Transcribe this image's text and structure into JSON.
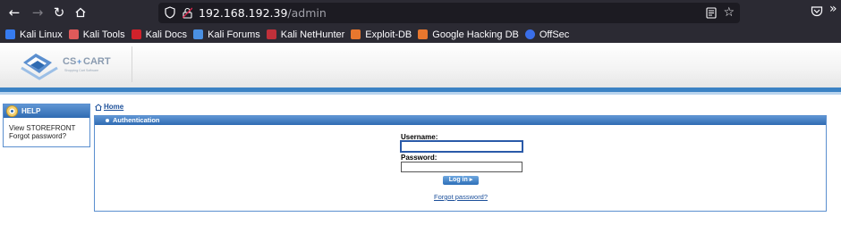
{
  "browser": {
    "url_host": "192.168.192.39",
    "url_path": "/admin",
    "bookmarks": [
      {
        "label": "Kali Linux",
        "icon": "kali-dragon-icon"
      },
      {
        "label": "Kali Tools",
        "icon": "kali-tools-icon"
      },
      {
        "label": "Kali Docs",
        "icon": "kali-docs-icon"
      },
      {
        "label": "Kali Forums",
        "icon": "kali-forums-icon"
      },
      {
        "label": "Kali NetHunter",
        "icon": "kali-nethunter-icon"
      },
      {
        "label": "Exploit-DB",
        "icon": "exploit-db-icon"
      },
      {
        "label": "Google Hacking DB",
        "icon": "ghdb-icon"
      },
      {
        "label": "OffSec",
        "icon": "offsec-icon"
      }
    ]
  },
  "sidebar": {
    "help_title": "HELP",
    "links": [
      "View STOREFRONT",
      "Forgot password?"
    ]
  },
  "breadcrumb": {
    "home_label": "Home"
  },
  "auth": {
    "title": "Authentication",
    "username_label": "Username:",
    "password_label": "Password:",
    "login_button": "Log in",
    "forgot_link": "Forgot password?"
  },
  "colors": {
    "accent": "#3b82c4",
    "link": "#1b4f9a",
    "browser_bg": "#2b2a33"
  }
}
